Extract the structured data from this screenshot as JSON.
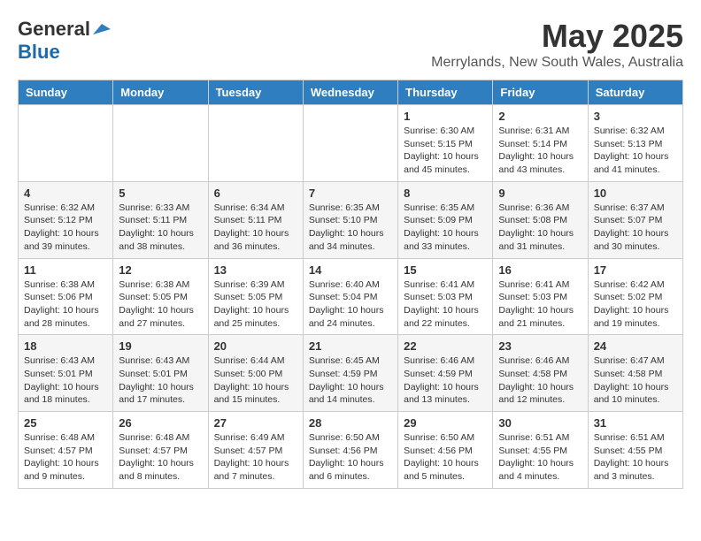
{
  "header": {
    "logo_general": "General",
    "logo_blue": "Blue",
    "month_title": "May 2025",
    "location": "Merrylands, New South Wales, Australia"
  },
  "weekdays": [
    "Sunday",
    "Monday",
    "Tuesday",
    "Wednesday",
    "Thursday",
    "Friday",
    "Saturday"
  ],
  "weeks": [
    [
      {
        "day": "",
        "info": ""
      },
      {
        "day": "",
        "info": ""
      },
      {
        "day": "",
        "info": ""
      },
      {
        "day": "",
        "info": ""
      },
      {
        "day": "1",
        "info": "Sunrise: 6:30 AM\nSunset: 5:15 PM\nDaylight: 10 hours\nand 45 minutes."
      },
      {
        "day": "2",
        "info": "Sunrise: 6:31 AM\nSunset: 5:14 PM\nDaylight: 10 hours\nand 43 minutes."
      },
      {
        "day": "3",
        "info": "Sunrise: 6:32 AM\nSunset: 5:13 PM\nDaylight: 10 hours\nand 41 minutes."
      }
    ],
    [
      {
        "day": "4",
        "info": "Sunrise: 6:32 AM\nSunset: 5:12 PM\nDaylight: 10 hours\nand 39 minutes."
      },
      {
        "day": "5",
        "info": "Sunrise: 6:33 AM\nSunset: 5:11 PM\nDaylight: 10 hours\nand 38 minutes."
      },
      {
        "day": "6",
        "info": "Sunrise: 6:34 AM\nSunset: 5:11 PM\nDaylight: 10 hours\nand 36 minutes."
      },
      {
        "day": "7",
        "info": "Sunrise: 6:35 AM\nSunset: 5:10 PM\nDaylight: 10 hours\nand 34 minutes."
      },
      {
        "day": "8",
        "info": "Sunrise: 6:35 AM\nSunset: 5:09 PM\nDaylight: 10 hours\nand 33 minutes."
      },
      {
        "day": "9",
        "info": "Sunrise: 6:36 AM\nSunset: 5:08 PM\nDaylight: 10 hours\nand 31 minutes."
      },
      {
        "day": "10",
        "info": "Sunrise: 6:37 AM\nSunset: 5:07 PM\nDaylight: 10 hours\nand 30 minutes."
      }
    ],
    [
      {
        "day": "11",
        "info": "Sunrise: 6:38 AM\nSunset: 5:06 PM\nDaylight: 10 hours\nand 28 minutes."
      },
      {
        "day": "12",
        "info": "Sunrise: 6:38 AM\nSunset: 5:05 PM\nDaylight: 10 hours\nand 27 minutes."
      },
      {
        "day": "13",
        "info": "Sunrise: 6:39 AM\nSunset: 5:05 PM\nDaylight: 10 hours\nand 25 minutes."
      },
      {
        "day": "14",
        "info": "Sunrise: 6:40 AM\nSunset: 5:04 PM\nDaylight: 10 hours\nand 24 minutes."
      },
      {
        "day": "15",
        "info": "Sunrise: 6:41 AM\nSunset: 5:03 PM\nDaylight: 10 hours\nand 22 minutes."
      },
      {
        "day": "16",
        "info": "Sunrise: 6:41 AM\nSunset: 5:03 PM\nDaylight: 10 hours\nand 21 minutes."
      },
      {
        "day": "17",
        "info": "Sunrise: 6:42 AM\nSunset: 5:02 PM\nDaylight: 10 hours\nand 19 minutes."
      }
    ],
    [
      {
        "day": "18",
        "info": "Sunrise: 6:43 AM\nSunset: 5:01 PM\nDaylight: 10 hours\nand 18 minutes."
      },
      {
        "day": "19",
        "info": "Sunrise: 6:43 AM\nSunset: 5:01 PM\nDaylight: 10 hours\nand 17 minutes."
      },
      {
        "day": "20",
        "info": "Sunrise: 6:44 AM\nSunset: 5:00 PM\nDaylight: 10 hours\nand 15 minutes."
      },
      {
        "day": "21",
        "info": "Sunrise: 6:45 AM\nSunset: 4:59 PM\nDaylight: 10 hours\nand 14 minutes."
      },
      {
        "day": "22",
        "info": "Sunrise: 6:46 AM\nSunset: 4:59 PM\nDaylight: 10 hours\nand 13 minutes."
      },
      {
        "day": "23",
        "info": "Sunrise: 6:46 AM\nSunset: 4:58 PM\nDaylight: 10 hours\nand 12 minutes."
      },
      {
        "day": "24",
        "info": "Sunrise: 6:47 AM\nSunset: 4:58 PM\nDaylight: 10 hours\nand 10 minutes."
      }
    ],
    [
      {
        "day": "25",
        "info": "Sunrise: 6:48 AM\nSunset: 4:57 PM\nDaylight: 10 hours\nand 9 minutes."
      },
      {
        "day": "26",
        "info": "Sunrise: 6:48 AM\nSunset: 4:57 PM\nDaylight: 10 hours\nand 8 minutes."
      },
      {
        "day": "27",
        "info": "Sunrise: 6:49 AM\nSunset: 4:57 PM\nDaylight: 10 hours\nand 7 minutes."
      },
      {
        "day": "28",
        "info": "Sunrise: 6:50 AM\nSunset: 4:56 PM\nDaylight: 10 hours\nand 6 minutes."
      },
      {
        "day": "29",
        "info": "Sunrise: 6:50 AM\nSunset: 4:56 PM\nDaylight: 10 hours\nand 5 minutes."
      },
      {
        "day": "30",
        "info": "Sunrise: 6:51 AM\nSunset: 4:55 PM\nDaylight: 10 hours\nand 4 minutes."
      },
      {
        "day": "31",
        "info": "Sunrise: 6:51 AM\nSunset: 4:55 PM\nDaylight: 10 hours\nand 3 minutes."
      }
    ]
  ]
}
